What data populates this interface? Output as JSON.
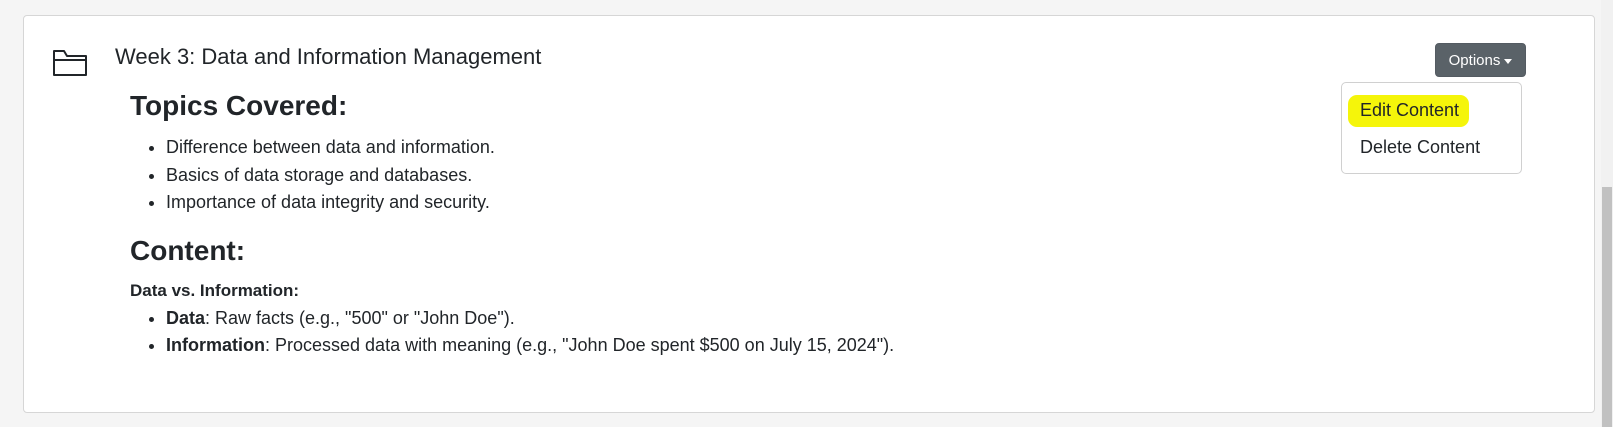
{
  "card": {
    "title": "Week 3: Data and Information Management",
    "icon": "folder-icon"
  },
  "options": {
    "label": "Options",
    "menu": {
      "edit_label": "Edit Content",
      "delete_label": "Delete Content",
      "highlight_color": "#f5f50a"
    }
  },
  "topics": {
    "heading": "Topics Covered:",
    "items": [
      "Difference between data and information.",
      "Basics of data storage and databases.",
      "Importance of data integrity and security."
    ]
  },
  "content": {
    "heading": "Content:",
    "subheading": "Data vs. Information:",
    "items": [
      {
        "term": "Data",
        "desc": ": Raw facts (e.g., \"500\" or \"John Doe\")."
      },
      {
        "term": "Information",
        "desc": ": Processed data with meaning (e.g., \"John Doe spent $500 on July 15, 2024\")."
      }
    ]
  },
  "colors": {
    "button_bg": "#5a6268",
    "text": "#212529"
  }
}
